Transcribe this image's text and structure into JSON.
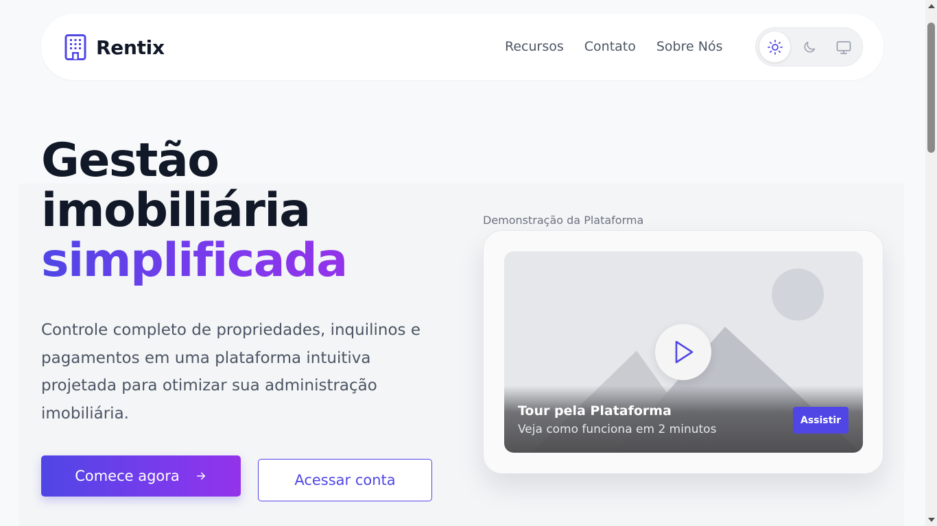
{
  "brand": {
    "name": "Rentix",
    "icon": "building-icon"
  },
  "nav": {
    "links": [
      "Recursos",
      "Contato",
      "Sobre Nós"
    ]
  },
  "theme_switch": {
    "options": [
      "sun-icon",
      "moon-icon",
      "monitor-icon"
    ],
    "active": "sun-icon"
  },
  "hero": {
    "headline_line1": "Gestão",
    "headline_line2": "imobiliária",
    "headline_highlight": "simplificada",
    "subtitle": "Controle completo de propriedades, inquilinos e pagamentos em uma plataforma intuitiva projetada para otimizar sua administração imobiliária.",
    "primary_cta": "Comece agora",
    "primary_cta_icon": "arrow-right-icon",
    "secondary_cta": "Acessar conta"
  },
  "demo": {
    "label": "Demonstração da Plataforma",
    "video_title": "Tour pela Plataforma",
    "video_subtitle": "Veja como funciona em 2 minutos",
    "watch_label": "Assistir"
  },
  "colors": {
    "accent": "#4f46e5",
    "accent_purple": "#9333ea",
    "text_dark": "#111827",
    "text_muted": "#4b5563",
    "background": "#f8f9fb"
  }
}
